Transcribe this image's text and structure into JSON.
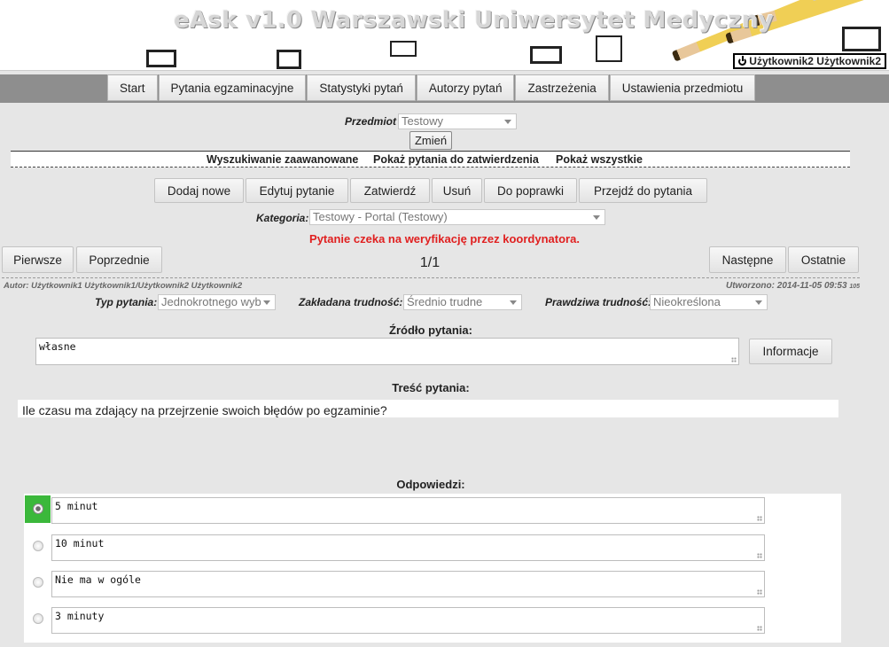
{
  "header": {
    "title": "eAsk v1.0 Warszawski Uniwersytet Medyczny",
    "user": "Użytkownik2 Użytkownik2",
    "logout_icon": "power-icon"
  },
  "nav": {
    "items": [
      "Start",
      "Pytania egzaminacyjne",
      "Statystyki pytań",
      "Autorzy pytań",
      "Zastrzeżenia",
      "Ustawienia przedmiotu"
    ]
  },
  "subject": {
    "label": "Przedmiot",
    "value": "Testowy",
    "change_button": "Zmień"
  },
  "links": {
    "advanced_search": "Wyszukiwanie zaawanowane",
    "show_pending": "Pokaż pytania do zatwierdzenia",
    "show_all": "Pokaż wszystkie"
  },
  "toolbar": {
    "add": "Dodaj nowe",
    "edit": "Edytuj pytanie",
    "approve": "Zatwierdź",
    "delete": "Usuń",
    "to_fix": "Do poprawki",
    "goto": "Przejdź do pytania"
  },
  "category": {
    "label": "Kategoria:",
    "value": "Testowy - Portal (Testowy)"
  },
  "status_message": "Pytanie czeka na weryfikację przez koordynatora.",
  "status_color": "#e02020",
  "pagination": {
    "first": "Pierwsze",
    "previous": "Poprzednie",
    "counter": "1/1",
    "next": "Następne",
    "last": "Ostatnie"
  },
  "meta": {
    "author": "Autor: Użytkownik1 Użytkownik1/Użytkownik2 Użytkownik2",
    "created_label": "Utworzono:",
    "created_value": "2014-11-05 09:53",
    "created_suffix": "105"
  },
  "fields": {
    "type_label": "Typ pytania:",
    "type_value": "Jednokrotnego wyb",
    "assumed_label": "Zakładana trudność:",
    "assumed_value": "Średnio trudne",
    "real_label": "Prawdziwa trudność:",
    "real_value": "Nieokreślona"
  },
  "source": {
    "title": "Źródło pytania:",
    "value": "własne",
    "info_button": "Informacje"
  },
  "question": {
    "title": "Treść pytania:",
    "text": "Ile czasu ma zdający na przejrzenie swoich błędów po egzaminie?"
  },
  "answers": {
    "title": "Odpowiedzi:",
    "correct_color": "#3bb83b",
    "items": [
      {
        "text": "5 minut",
        "correct": true
      },
      {
        "text": "10 minut",
        "correct": false
      },
      {
        "text": "Nie ma w ogóle",
        "correct": false
      },
      {
        "text": "3 minuty",
        "correct": false
      }
    ]
  }
}
